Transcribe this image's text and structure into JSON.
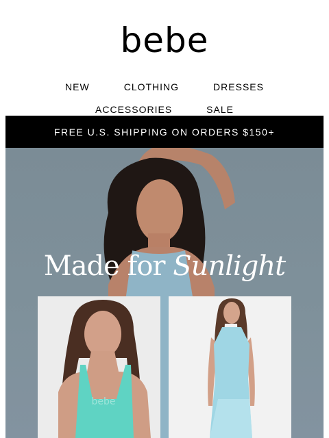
{
  "brand": {
    "logo": "bebe"
  },
  "nav": {
    "row1": [
      "NEW",
      "CLOTHING",
      "DRESSES"
    ],
    "row2": [
      "ACCESSORIES",
      "SALE"
    ]
  },
  "promo": {
    "shipping": "FREE U.S. SHIPPING ON ORDERS $150+"
  },
  "hero": {
    "headline_regular": "Made for",
    "headline_italic": "Sunlight",
    "products": [
      {
        "icon": "turquoise-tank-top-photo",
        "tank_logo": "bebe"
      },
      {
        "icon": "blue-lace-maxi-dress-photo"
      }
    ]
  },
  "colors": {
    "shipping_bar": "#000000",
    "hero_background": "#7f919b",
    "tank": "#5fd3c3",
    "dress": "#9fd6e4"
  }
}
